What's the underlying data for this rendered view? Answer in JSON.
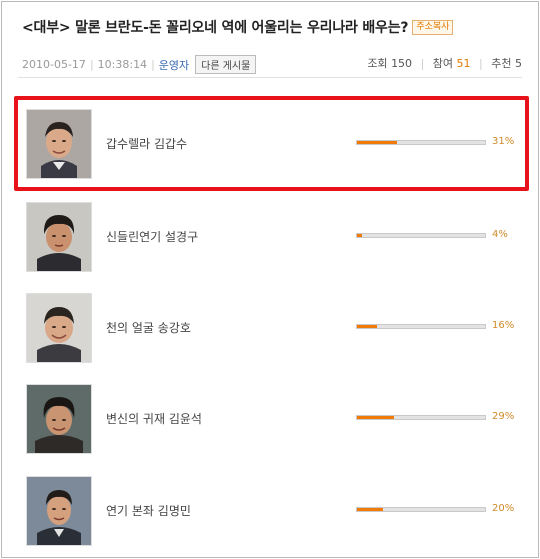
{
  "post": {
    "title": "<대부> 말론 브란도-돈 꼴리오네 역에 어울리는 우리나라 배우는?",
    "copy_label": "주소복사",
    "date": "2010-05-17",
    "time": "10:38:14",
    "author": "운영자",
    "board_button": "다른 게시물",
    "views_label": "조회",
    "views": "150",
    "participants_label": "참여",
    "participants": "51",
    "recommend_label": "추천",
    "recommend": "5"
  },
  "poll": {
    "options": [
      {
        "label": "갑수렐라 김갑수",
        "percent": 31,
        "percent_text": "31%",
        "selected": true
      },
      {
        "label": "신들린연기 설경구",
        "percent": 4,
        "percent_text": "4%",
        "selected": false
      },
      {
        "label": "천의 얼굴 송강호",
        "percent": 16,
        "percent_text": "16%",
        "selected": false
      },
      {
        "label": "변신의 귀재 김윤석",
        "percent": 29,
        "percent_text": "29%",
        "selected": false
      },
      {
        "label": "연기 본좌 김명민",
        "percent": 20,
        "percent_text": "20%",
        "selected": false
      }
    ],
    "bar_color": "#f07a0a",
    "highlight_color": "#e8121a"
  }
}
